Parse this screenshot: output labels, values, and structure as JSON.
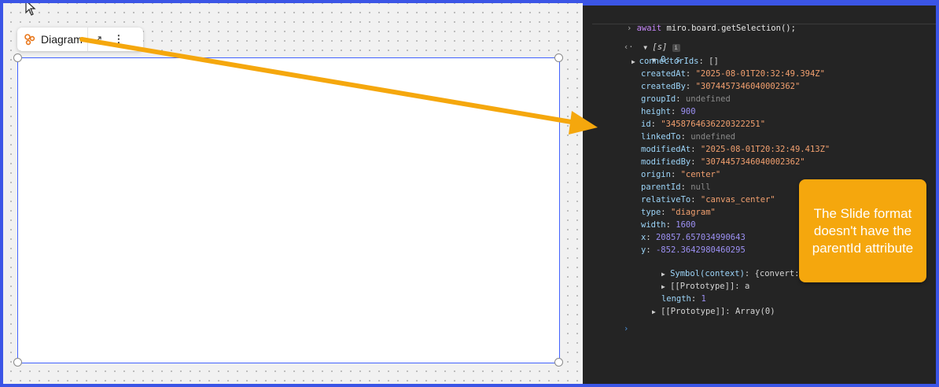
{
  "toolbar": {
    "label": "Diagram",
    "expand_glyph": "↗",
    "more_glyph": "⋮"
  },
  "console": {
    "command": {
      "kw": "await",
      "text": " miro.",
      "obj": "board",
      "dot": ".",
      "method": "getSelection",
      "end": "();"
    },
    "result_head": "[s]",
    "item_head": "0: s",
    "properties": [
      {
        "key": "connectorIds",
        "value": "[]",
        "kind": "plain",
        "expandable": true
      },
      {
        "key": "createdAt",
        "value": "\"2025-08-01T20:32:49.394Z\"",
        "kind": "str"
      },
      {
        "key": "createdBy",
        "value": "\"3074457346040002362\"",
        "kind": "str"
      },
      {
        "key": "groupId",
        "value": "undefined",
        "kind": "undef"
      },
      {
        "key": "height",
        "value": "900",
        "kind": "num"
      },
      {
        "key": "id",
        "value": "\"3458764636220322251\"",
        "kind": "str"
      },
      {
        "key": "linkedTo",
        "value": "undefined",
        "kind": "undef"
      },
      {
        "key": "modifiedAt",
        "value": "\"2025-08-01T20:32:49.413Z\"",
        "kind": "str"
      },
      {
        "key": "modifiedBy",
        "value": "\"3074457346040002362\"",
        "kind": "str"
      },
      {
        "key": "origin",
        "value": "\"center\"",
        "kind": "str"
      },
      {
        "key": "parentId",
        "value": "null",
        "kind": "undef"
      },
      {
        "key": "relativeTo",
        "value": "\"canvas_center\"",
        "kind": "str"
      },
      {
        "key": "type",
        "value": "\"diagram\"",
        "kind": "str"
      },
      {
        "key": "width",
        "value": "1600",
        "kind": "num"
      },
      {
        "key": "x",
        "value": "20857.657034990643",
        "kind": "num"
      },
      {
        "key": "y",
        "value": "-852.3642980460295",
        "kind": "num"
      }
    ],
    "symbol_line": {
      "key": "Symbol(context)",
      "value": "{convert: ƒ}"
    },
    "proto_a": {
      "key": "[[Prototype]]",
      "value": "a"
    },
    "length_line": {
      "key": "length",
      "value": "1"
    },
    "proto_array": {
      "key": "[[Prototype]]",
      "value": "Array(0)"
    },
    "prompt_glyph": "›",
    "return_glyph": "‹·",
    "info_glyph": "i"
  },
  "callout": {
    "text": "The Slide format doesn't have the parentId attribute"
  },
  "colors": {
    "frame": "#3b55e6",
    "callout": "#f5a70d",
    "arrow": "#f5a70d",
    "selection": "#4262ff",
    "console_bg": "#242424"
  }
}
